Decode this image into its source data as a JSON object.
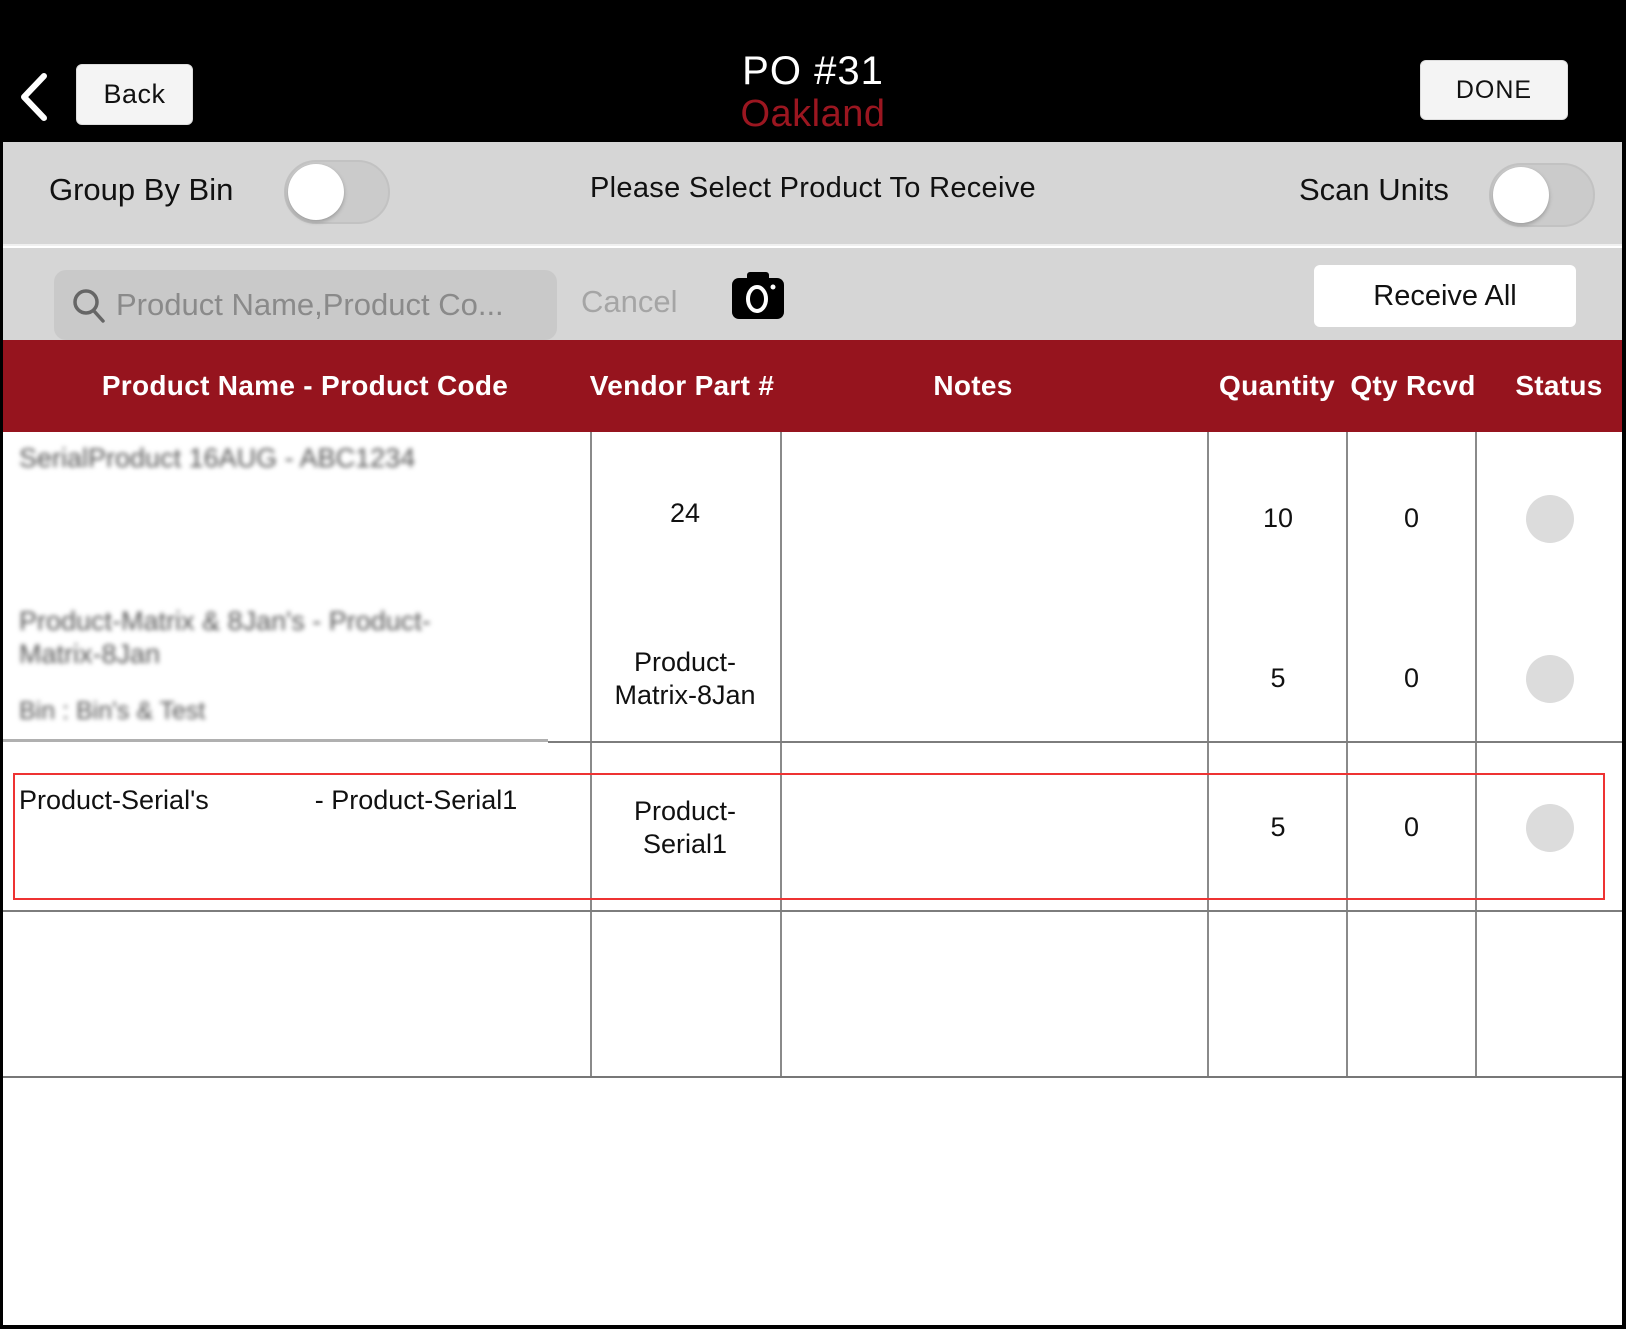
{
  "header": {
    "back_label": "Back",
    "title": "PO #31",
    "location": "Oakland",
    "done_label": "DONE"
  },
  "options": {
    "group_by_bin_label": "Group By Bin",
    "group_by_bin_on": false,
    "instruction": "Please Select Product To Receive",
    "scan_units_label": "Scan Units",
    "scan_units_on": false
  },
  "search": {
    "placeholder": "Product Name,Product Co...",
    "value": "",
    "cancel_label": "Cancel",
    "receive_all_label": "Receive All"
  },
  "table": {
    "columns": [
      "Product Name - Product Code",
      "Vendor Part #",
      "Notes",
      "Quantity",
      "Qty Rcvd",
      "Status"
    ],
    "rows": [
      {
        "name": "SerialProduct 16AUG - ABC1234",
        "bin": "",
        "vendor_part": "24",
        "notes": "",
        "quantity": "10",
        "qty_rcvd": "0",
        "blurred": true
      },
      {
        "name": "Product-Matrix & 8Jan's - Product-Matrix-8Jan",
        "bin": "Bin : Bin's & Test",
        "vendor_part": "Product-Matrix-8Jan",
        "notes": "",
        "quantity": "5",
        "qty_rcvd": "0",
        "blurred": true
      },
      {
        "name": "Product-Serial's",
        "code": "- Product-Serial1",
        "bin": "",
        "vendor_part": "Product-Serial1",
        "notes": "",
        "quantity": "5",
        "qty_rcvd": "0",
        "blurred": false
      }
    ]
  },
  "colors": {
    "accent": "#96141e",
    "location_text": "#9b1620",
    "highlight": "#e33333"
  }
}
